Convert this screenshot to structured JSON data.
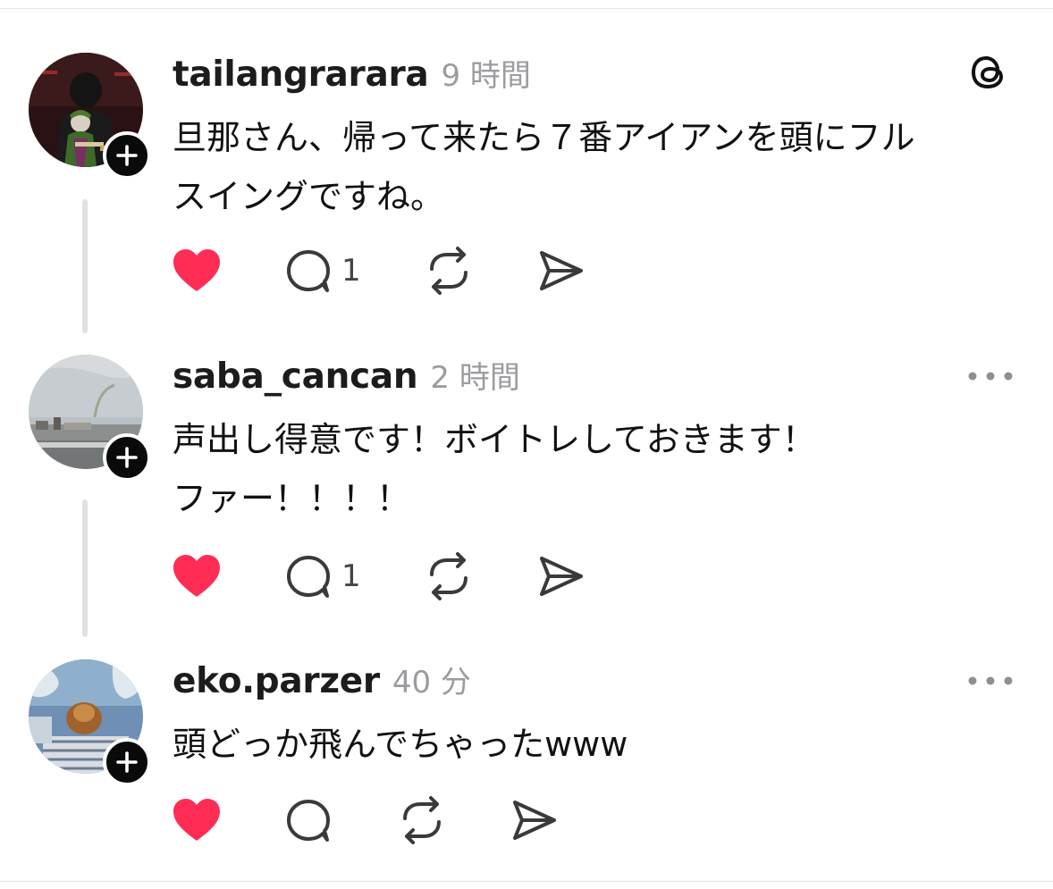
{
  "posts": [
    {
      "username": "tailangrarara",
      "time": "9 時間",
      "text_lines": [
        "旦那さん、帰って来たら７番アイアンを頭にフル",
        "スイングですね。"
      ],
      "reply_count": "1",
      "liked": true
    },
    {
      "username": "saba_cancan",
      "time": "2 時間",
      "text_lines": [
        "声出し得意です！ボイトレしておきます！",
        "ファー！！！！"
      ],
      "reply_count": "1",
      "liked": true
    },
    {
      "username": "eko.parzer",
      "time": "40 分",
      "text_lines": [
        "頭どっか飛んでちゃったwww"
      ],
      "reply_count": "",
      "liked": true
    }
  ],
  "icons": {
    "like": "heart-icon",
    "reply": "comment-icon",
    "repost": "repost-icon",
    "share": "send-icon",
    "follow": "plus-icon",
    "brand": "threads-logo-icon",
    "menu": "more-icon"
  },
  "colors": {
    "like": "#ff2d55",
    "text": "#1c1c1e",
    "muted": "#9c9ca0",
    "thread_line": "#e1e1e3"
  }
}
